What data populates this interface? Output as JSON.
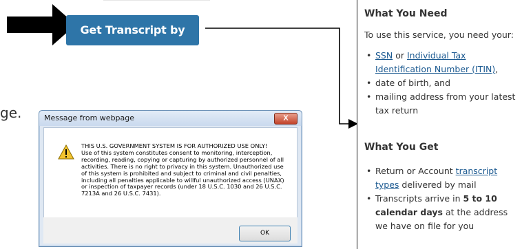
{
  "button": {
    "label": "Get Transcript by Mail"
  },
  "partial_text": "ge.",
  "dialog": {
    "title": "Message from webpage",
    "close_label": "X",
    "message": "THIS U.S. GOVERNMENT SYSTEM IS FOR AUTHORIZED USE ONLY!\nUse of this system constitutes consent to monitoring, interception,\nrecording, reading, copying or capturing by authorized personnel of all\nactivities.  There is no right to privacy in this system.  Unauthorized use\nof this system is prohibited and subject to criminal and civil penalties,\nincluding all penalties applicable to willful unauthorized access (UNAX)\nor inspection of taxpayer records (under 18 U.S.C. 1030 and 26 U.S.C.\n7213A and 26 U.S.C. 7431).",
    "ok_label": "OK",
    "icon": "warning-icon"
  },
  "panel": {
    "need_heading": "What You Need",
    "need_intro": "To use this service, you need your:",
    "need_item1_link1": "SSN",
    "need_item1_or": " or ",
    "need_item1_link2": "Individual Tax Identification Number (ITIN)",
    "need_item1_tail": ",",
    "need_item2": "date of birth, and",
    "need_item3": "mailing address from your latest tax return",
    "get_heading": "What You Get",
    "get_item1_pre": "Return or Account ",
    "get_item1_link": "transcript types",
    "get_item1_post": " delivered by mail",
    "get_item2_pre": "Transcripts arrive in ",
    "get_item2_bold": "5 to 10 calendar days",
    "get_item2_post": " at the address we have on file for you"
  },
  "colors": {
    "button": "#2e75a8",
    "link": "#1c5a91"
  }
}
